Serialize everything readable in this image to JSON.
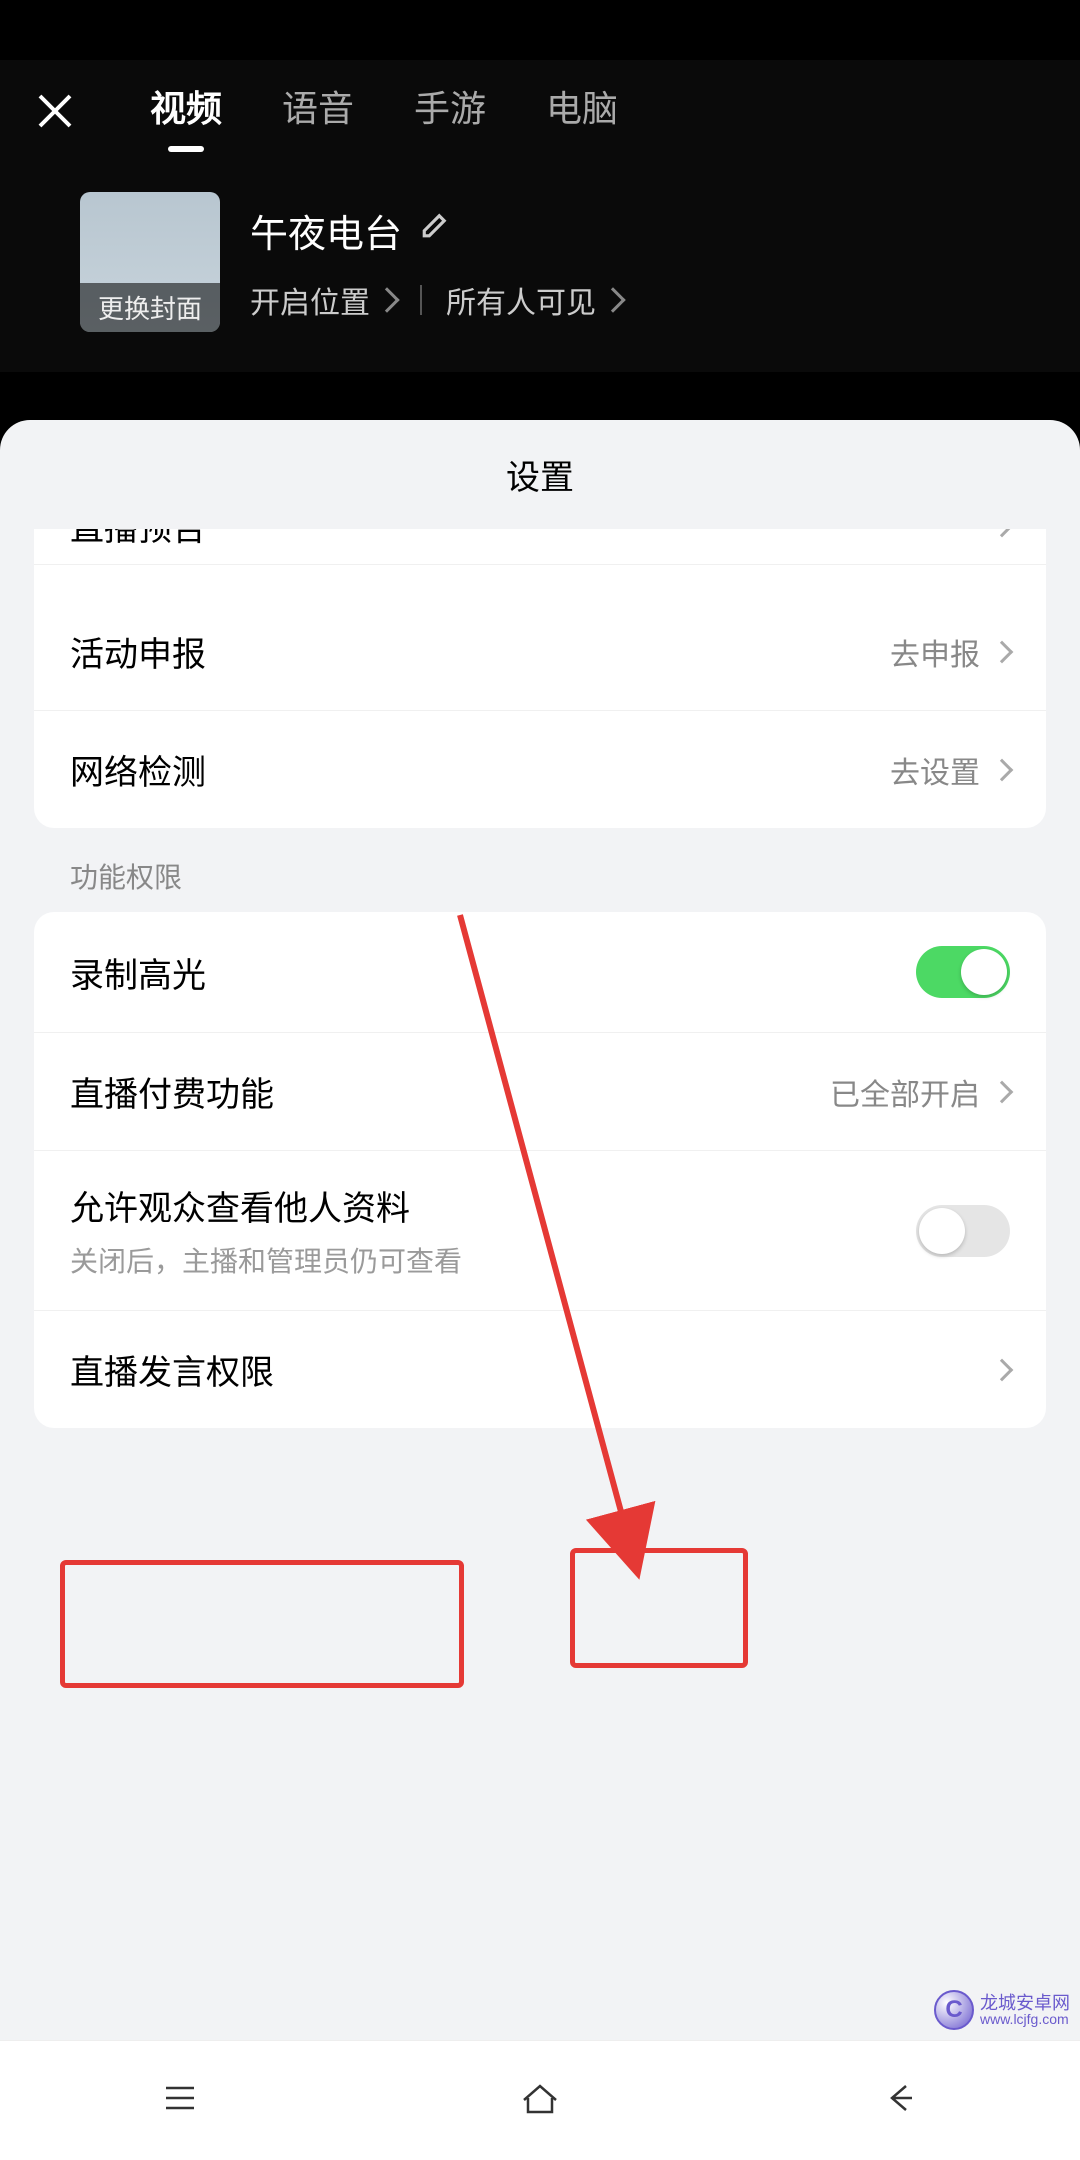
{
  "tabs": {
    "video": "视频",
    "voice": "语音",
    "mobile_game": "手游",
    "pc": "电脑"
  },
  "room": {
    "cover_label": "更换封面",
    "title": "午夜电台",
    "location_label": "开启位置",
    "visibility_label": "所有人可见"
  },
  "sheet": {
    "title": "设置",
    "partial_row_label": "直播预告",
    "activity_report": {
      "label": "活动申报",
      "action": "去申报"
    },
    "network_check": {
      "label": "网络检测",
      "action": "去设置"
    },
    "permissions_section": "功能权限",
    "record_highlight": {
      "label": "录制高光"
    },
    "paid_feature": {
      "label": "直播付费功能",
      "status": "已全部开启"
    },
    "viewer_profile": {
      "label": "允许观众查看他人资料",
      "sub": "关闭后，主播和管理员仍可查看"
    },
    "speak_permission": {
      "label": "直播发言权限"
    }
  },
  "watermark": {
    "brand": "龙城安卓网",
    "url": "www.lcjfg.com",
    "letter": "C"
  }
}
